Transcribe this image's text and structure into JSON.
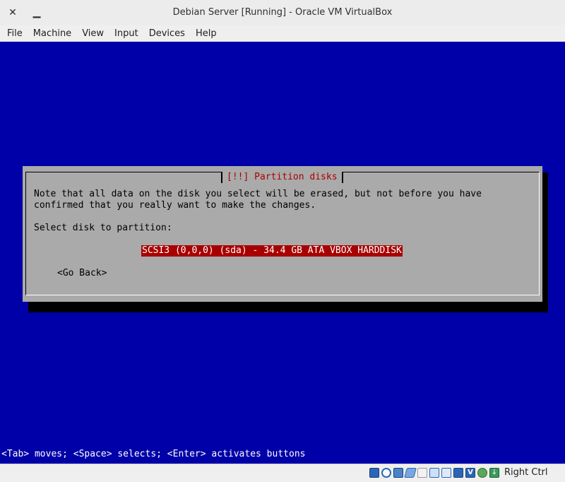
{
  "window": {
    "title": "Debian Server [Running] - Oracle VM VirtualBox",
    "close_glyph": "✕",
    "minimize_glyph": "▁"
  },
  "menubar": {
    "items": [
      {
        "label": "File"
      },
      {
        "label": "Machine"
      },
      {
        "label": "View"
      },
      {
        "label": "Input"
      },
      {
        "label": "Devices"
      },
      {
        "label": "Help"
      }
    ]
  },
  "installer": {
    "background_color": "#0000a8",
    "dialog": {
      "title": "[!!] Partition disks",
      "message_line1": "Note that all data on the disk you select will be erased, but not before you have",
      "message_line2": "confirmed that you really want to make the changes.",
      "prompt": "Select disk to partition:",
      "disk_option": "SCSI3 (0,0,0) (sda) - 34.4 GB ATA VBOX HARDDISK",
      "go_back": "<Go Back>",
      "selected_color": "#a80000"
    },
    "help_line": "<Tab> moves; <Space> selects; <Enter> activates buttons"
  },
  "statusbar": {
    "icons": [
      {
        "name": "hard-disk-icon"
      },
      {
        "name": "optical-drive-icon"
      },
      {
        "name": "audio-icon"
      },
      {
        "name": "network-icon"
      },
      {
        "name": "usb-icon"
      },
      {
        "name": "shared-folders-icon"
      },
      {
        "name": "display-icon"
      },
      {
        "name": "recording-icon",
        "glyph": ""
      },
      {
        "name": "vt-x-icon",
        "glyph": "V"
      },
      {
        "name": "guest-additions-icon"
      },
      {
        "name": "mouse-integration-icon",
        "glyph": "↓"
      }
    ],
    "host_key": "Right Ctrl"
  }
}
